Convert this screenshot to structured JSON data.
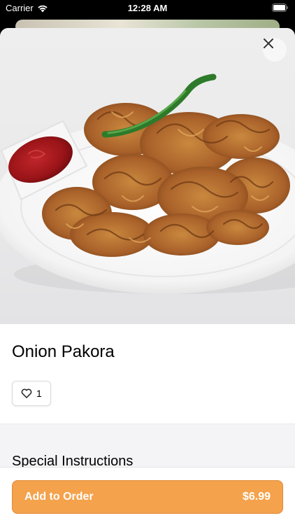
{
  "status_bar": {
    "carrier": "Carrier",
    "time": "12:28 AM"
  },
  "item": {
    "name": "Onion Pakora",
    "like_count": "1",
    "image_icon": "onion-pakora-photo"
  },
  "sections": {
    "special_instructions_title": "Special Instructions"
  },
  "footer": {
    "add_label": "Add to Order",
    "price": "$6.99"
  },
  "colors": {
    "accent": "#f4a24c",
    "accent_border": "#e1893a"
  }
}
